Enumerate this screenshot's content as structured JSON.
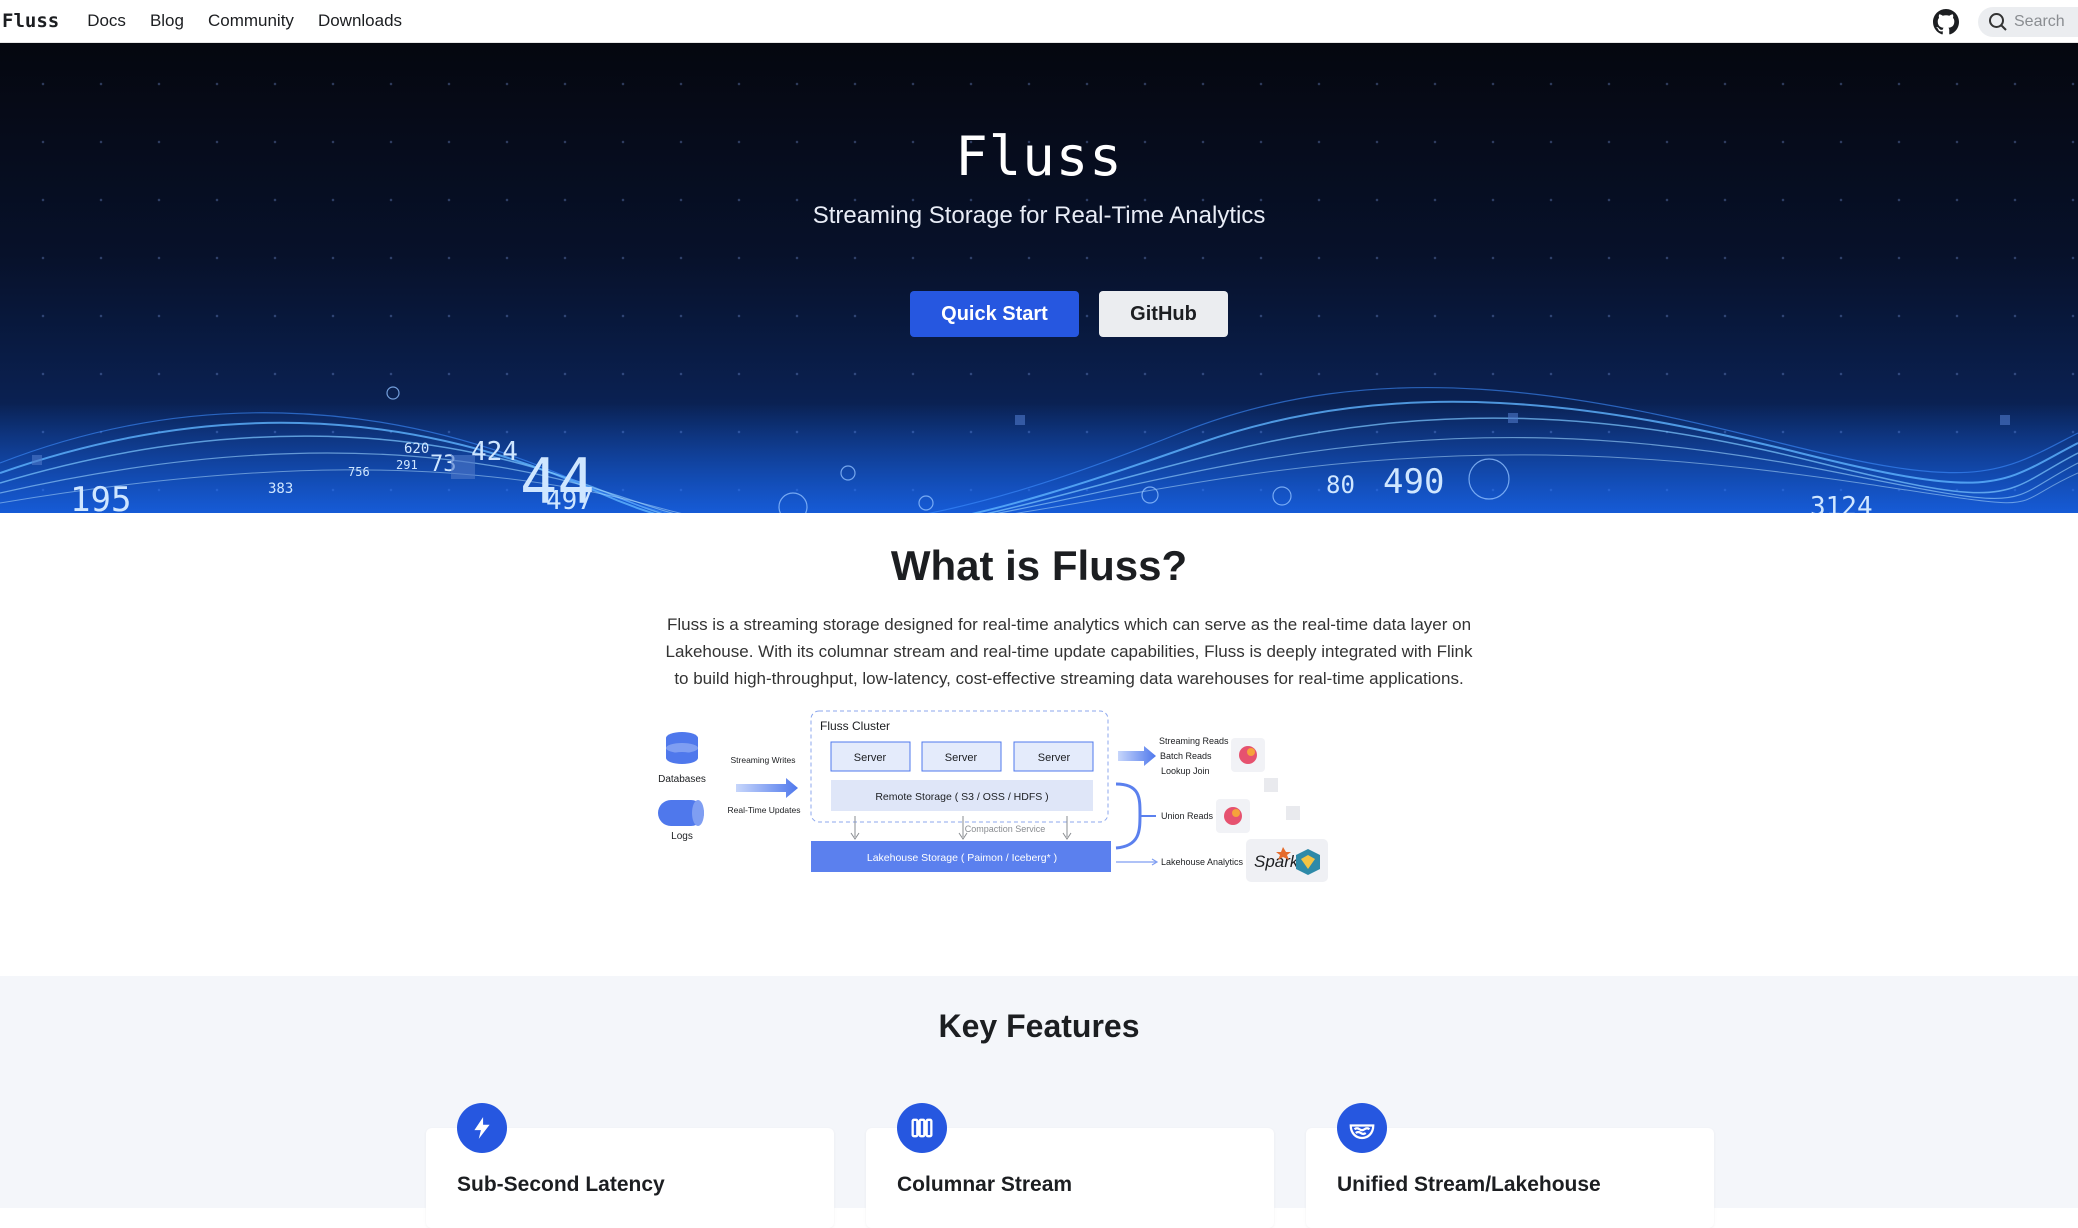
{
  "navbar": {
    "brand": "Fluss",
    "links": [
      "Docs",
      "Blog",
      "Community",
      "Downloads"
    ],
    "search_placeholder": "Search",
    "github_icon": "github-icon",
    "search_icon": "search-icon"
  },
  "hero": {
    "title": "Fluss",
    "subtitle": "Streaming Storage for Real-Time Analytics",
    "primary_button": "Quick Start",
    "secondary_button": "GitHub",
    "decor_numbers": [
      "195",
      "383",
      "756",
      "620",
      "291",
      "73",
      "424",
      "44",
      "497",
      "80",
      "490",
      "3124"
    ]
  },
  "what": {
    "title": "What is Fluss?",
    "description": "Fluss is a streaming storage designed for real-time analytics which can serve as the real-time data layer on Lakehouse. With its columnar stream and real-time update capabilities, Fluss is deeply integrated with Flink to build high-throughput, low-latency, cost-effective streaming data warehouses for real-time applications."
  },
  "diagram": {
    "cluster_label": "Fluss Cluster",
    "servers": [
      "Server",
      "Server",
      "Server"
    ],
    "remote_storage": "Remote Storage ( S3 / OSS / HDFS )",
    "compaction": "Compaction Service",
    "lakehouse_storage": "Lakehouse Storage  ( Paimon / Iceberg* )",
    "sources": [
      "Databases",
      "Logs"
    ],
    "source_flows": [
      "Streaming Writes",
      "Real-Time Updates"
    ],
    "reads": [
      "Streaming Reads",
      "Batch Reads",
      "Lookup Join"
    ],
    "union_reads": "Union Reads",
    "lakehouse_analytics": "Lakehouse Analytics",
    "spark_label": "Spark",
    "colors": {
      "accent": "#2657e0",
      "panel": "#dfe6f8",
      "lake": "#5b80ee"
    }
  },
  "features": {
    "title": "Key Features",
    "cards": [
      {
        "title": "Sub-Second Latency",
        "icon": "lightning-icon"
      },
      {
        "title": "Columnar Stream",
        "icon": "columns-icon"
      },
      {
        "title": "Unified Stream/Lakehouse",
        "icon": "lake-icon"
      }
    ]
  }
}
